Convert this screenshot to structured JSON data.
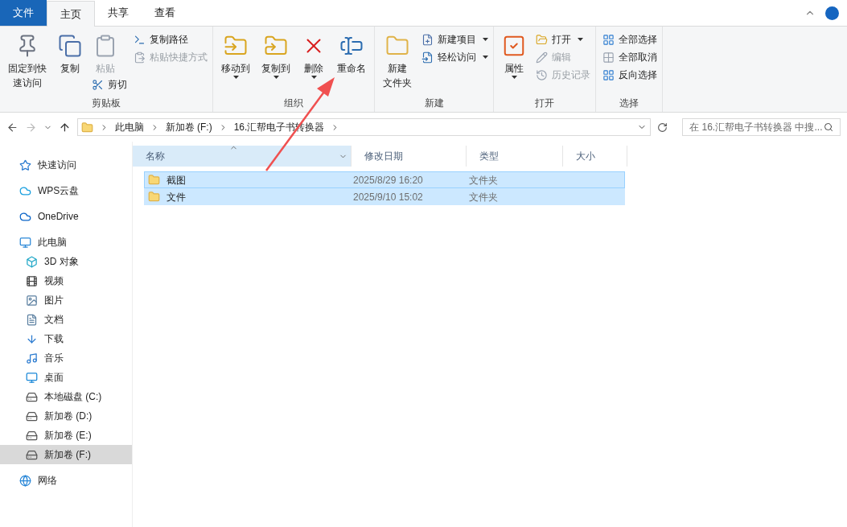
{
  "ribbon": {
    "tabs": [
      {
        "label": "文件",
        "kind": "file",
        "selected": false
      },
      {
        "label": "主页",
        "kind": "tab",
        "selected": true
      },
      {
        "label": "共享",
        "kind": "tab",
        "selected": false
      },
      {
        "label": "查看",
        "kind": "tab",
        "selected": false
      }
    ],
    "groups": [
      {
        "label": "剪贴板",
        "columns": [
          [
            {
              "kind": "large",
              "lines": [
                "固定到快",
                "速访问"
              ],
              "disabled": false,
              "dropdown": false
            }
          ],
          [
            {
              "kind": "large",
              "label": "复制",
              "disabled": false,
              "dropdown": false
            }
          ],
          [
            {
              "kind": "large",
              "label": "粘贴",
              "disabled": true,
              "dropdown": false
            },
            {
              "kind": "small",
              "label": "剪切",
              "disabled": false,
              "dropdown": false
            }
          ],
          [
            {
              "kind": "small",
              "label": "复制路径",
              "disabled": false,
              "dropdown": false
            },
            {
              "kind": "small",
              "label": "粘贴快捷方式",
              "disabled": true,
              "dropdown": false
            }
          ]
        ]
      },
      {
        "label": "组织",
        "columns": [
          [
            {
              "kind": "large",
              "label": "移动到",
              "disabled": false,
              "dropdown": true
            }
          ],
          [
            {
              "kind": "large",
              "label": "复制到",
              "disabled": false,
              "dropdown": true
            }
          ],
          [
            {
              "kind": "large",
              "label": "删除",
              "disabled": false,
              "dropdown": true
            }
          ],
          [
            {
              "kind": "large",
              "label": "重命名",
              "disabled": false,
              "dropdown": false
            }
          ]
        ]
      },
      {
        "label": "新建",
        "columns": [
          [
            {
              "kind": "large",
              "lines": [
                "新建",
                "文件夹"
              ],
              "disabled": false,
              "dropdown": false
            }
          ],
          [
            {
              "kind": "small",
              "label": "新建项目",
              "disabled": false,
              "dropdown": true
            },
            {
              "kind": "small",
              "label": "轻松访问",
              "disabled": false,
              "dropdown": true
            }
          ]
        ]
      },
      {
        "label": "打开",
        "columns": [
          [
            {
              "kind": "large",
              "label": "属性",
              "disabled": false,
              "dropdown": true
            }
          ],
          [
            {
              "kind": "small",
              "label": "打开",
              "disabled": false,
              "dropdown": true
            },
            {
              "kind": "small",
              "label": "编辑",
              "disabled": true,
              "dropdown": false
            },
            {
              "kind": "small",
              "label": "历史记录",
              "disabled": true,
              "dropdown": false
            }
          ]
        ]
      },
      {
        "label": "选择",
        "columns": [
          [
            {
              "kind": "small",
              "label": "全部选择",
              "disabled": false,
              "dropdown": false
            },
            {
              "kind": "small",
              "label": "全部取消",
              "disabled": false,
              "dropdown": false
            },
            {
              "kind": "small",
              "label": "反向选择",
              "disabled": false,
              "dropdown": false
            }
          ]
        ]
      }
    ]
  },
  "address_bar": {
    "crumbs": [
      "此电脑",
      "新加卷 (F:)",
      "16.汇帮电子书转换器"
    ]
  },
  "search": {
    "placeholder": "在 16.汇帮电子书转换器 中搜..."
  },
  "sidebar": {
    "items": [
      {
        "label": "快速访问",
        "selected": false
      },
      {
        "label": "WPS云盘",
        "selected": false
      },
      {
        "label": "OneDrive",
        "selected": false
      },
      {
        "label": "此电脑",
        "selected": false,
        "children": [
          {
            "label": "3D 对象",
            "selected": false
          },
          {
            "label": "视频",
            "selected": false
          },
          {
            "label": "图片",
            "selected": false
          },
          {
            "label": "文档",
            "selected": false
          },
          {
            "label": "下载",
            "selected": false
          },
          {
            "label": "音乐",
            "selected": false
          },
          {
            "label": "桌面",
            "selected": false
          },
          {
            "label": "本地磁盘 (C:)",
            "selected": false
          },
          {
            "label": "新加卷 (D:)",
            "selected": false
          },
          {
            "label": "新加卷 (E:)",
            "selected": false
          },
          {
            "label": "新加卷 (F:)",
            "selected": true
          }
        ]
      },
      {
        "label": "网络",
        "selected": false
      }
    ]
  },
  "table": {
    "columns": [
      {
        "label": "名称",
        "sorted": true
      },
      {
        "label": "修改日期",
        "sorted": false
      },
      {
        "label": "类型",
        "sorted": false
      },
      {
        "label": "大小",
        "sorted": false
      }
    ],
    "rows": [
      {
        "name": "截图",
        "modified": "2025/8/29 16:20",
        "type": "文件夹",
        "selected": true,
        "focused": true
      },
      {
        "name": "文件",
        "modified": "2025/9/10 15:02",
        "type": "文件夹",
        "selected": true,
        "focused": false
      }
    ]
  }
}
